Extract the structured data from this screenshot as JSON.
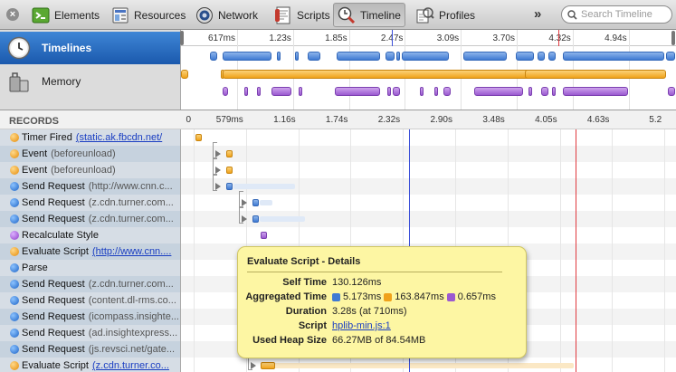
{
  "toolbar": {
    "close_label": "×",
    "tabs": [
      {
        "label": "Elements",
        "icon": "elements-icon"
      },
      {
        "label": "Resources",
        "icon": "resources-icon"
      },
      {
        "label": "Network",
        "icon": "network-icon"
      },
      {
        "label": "Scripts",
        "icon": "scripts-icon"
      },
      {
        "label": "Timeline",
        "icon": "timeline-icon",
        "selected": true
      },
      {
        "label": "Profiles",
        "icon": "profiles-icon"
      }
    ],
    "overflow": "»",
    "search_placeholder": "Search Timeline"
  },
  "overview": {
    "items": [
      {
        "label": "Timelines",
        "selected": true
      },
      {
        "label": "Memory",
        "selected": false
      }
    ],
    "ruler": [
      "617ms",
      "1.23s",
      "1.85s",
      "2.47s",
      "3.09s",
      "3.70s",
      "4.32s",
      "4.94s"
    ]
  },
  "records": {
    "title": "RECORDS",
    "ruler": [
      "0",
      "579ms",
      "1.16s",
      "1.74s",
      "2.32s",
      "2.90s",
      "3.48s",
      "4.05s",
      "4.63s",
      "5.2"
    ],
    "rows": [
      {
        "label": "Timer Fired",
        "detail": "(static.ak.fbcdn.net/",
        "link": true,
        "category": "orange"
      },
      {
        "label": "Event",
        "detail": "(beforeunload)",
        "link": false,
        "category": "orange"
      },
      {
        "label": "Event",
        "detail": "(beforeunload)",
        "link": false,
        "category": "orange"
      },
      {
        "label": "Send Request",
        "detail": "(http://www.cnn.c...",
        "link": false,
        "category": "blue"
      },
      {
        "label": "Send Request",
        "detail": "(z.cdn.turner.com...",
        "link": false,
        "category": "blue"
      },
      {
        "label": "Send Request",
        "detail": "(z.cdn.turner.com...",
        "link": false,
        "category": "blue"
      },
      {
        "label": "Recalculate Style",
        "detail": "",
        "link": false,
        "category": "purple"
      },
      {
        "label": "Evaluate Script",
        "detail": "(http://www.cnn....",
        "link": true,
        "category": "orange"
      },
      {
        "label": "Parse",
        "detail": "",
        "link": false,
        "category": "blue"
      },
      {
        "label": "Send Request",
        "detail": "(z.cdn.turner.com...",
        "link": false,
        "category": "blue"
      },
      {
        "label": "Send Request",
        "detail": "(content.dl-rms.co...",
        "link": false,
        "category": "blue"
      },
      {
        "label": "Send Request",
        "detail": "(icompass.insighte...",
        "link": false,
        "category": "blue"
      },
      {
        "label": "Send Request",
        "detail": "(ad.insightexpress...",
        "link": false,
        "category": "blue"
      },
      {
        "label": "Send Request",
        "detail": "(js.revsci.net/gate...",
        "link": false,
        "category": "blue"
      },
      {
        "label": "Evaluate Script",
        "detail": "(z.cdn.turner.co...",
        "link": true,
        "category": "orange"
      }
    ]
  },
  "popover": {
    "title": "Evaluate Script - Details",
    "self_time_label": "Self Time",
    "self_time": "130.126ms",
    "aggregated_label": "Aggregated Time",
    "aggregated": [
      {
        "color": "blue",
        "value": "5.173ms"
      },
      {
        "color": "orange",
        "value": "163.847ms"
      },
      {
        "color": "purple",
        "value": "0.657ms"
      }
    ],
    "duration_label": "Duration",
    "duration": "3.28s (at 710ms)",
    "script_label": "Script",
    "script": "hplib-min.js:1",
    "heap_label": "Used Heap Size",
    "heap": "66.27MB of 84.54MB"
  },
  "colors": {
    "loading": "#3f7ad3",
    "scripting": "#f0a21a",
    "rendering": "#9b59d0",
    "dom_content_loaded": "#3b4fd9",
    "load": "#e0393e",
    "selected_blue": "#1b59ad"
  }
}
